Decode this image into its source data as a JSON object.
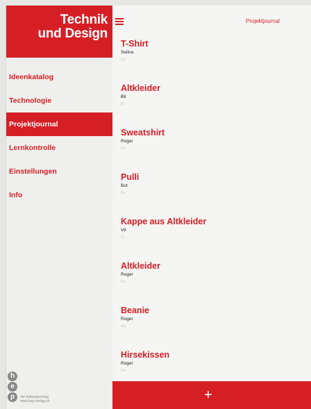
{
  "brand": {
    "line1": "Technik",
    "line2": "und Design"
  },
  "nav": {
    "items": [
      {
        "label": "Ideenkatalog"
      },
      {
        "label": "Technologie"
      },
      {
        "label": "Projektjournal"
      },
      {
        "label": "Lernkontrolle"
      },
      {
        "label": "Einstellungen"
      },
      {
        "label": "Info"
      }
    ],
    "active_index": 2
  },
  "topbar": {
    "title": "Projektjournal",
    "menu_icon": "hamburger-icon"
  },
  "entries": [
    {
      "title": "T-Shirt",
      "author": "Selina",
      "sub": "Sa"
    },
    {
      "title": "Altkleider",
      "author": "Bit",
      "sub": "Bi"
    },
    {
      "title": "Sweatshirt",
      "author": "Roger",
      "sub": "Ro"
    },
    {
      "title": "Pulli",
      "author": "But",
      "sub": "Bu"
    },
    {
      "title": "Kappe aus Altkleider",
      "author": "Vit",
      "sub": "Vi"
    },
    {
      "title": "Altkleider",
      "author": "Roger",
      "sub": "Ro"
    },
    {
      "title": "Beanie",
      "author": "Roger",
      "sub": "Ro"
    },
    {
      "title": "Hirsekissen",
      "author": "Roger",
      "sub": "Ro"
    }
  ],
  "footer": {
    "hep_letters": [
      "h",
      "e",
      "p"
    ],
    "hep_line1": "der bildungsverlag",
    "hep_line2": "www.hep-verlag.ch"
  },
  "addbar": {
    "icon": "plus-icon",
    "glyph": "+"
  },
  "colors": {
    "accent": "#d61e25",
    "sidebar_bg": "#efefed",
    "main_bg": "#f5f5f3"
  }
}
